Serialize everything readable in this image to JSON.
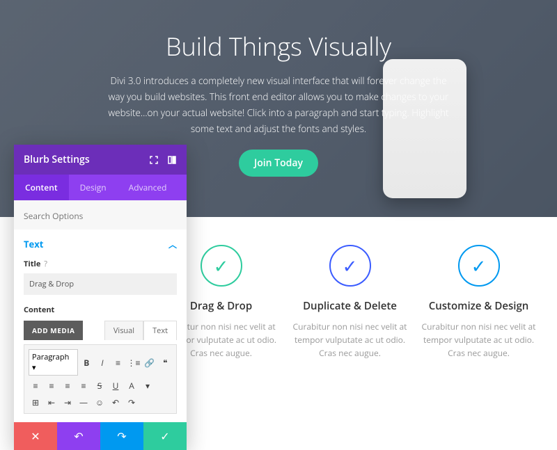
{
  "hero": {
    "title": "Build Things Visually",
    "subtitle": "Divi 3.0 introduces a completely new visual interface that will forever change the way you build websites. This front end editor allows you to make changes to your website...on your actual website! Click into a paragraph and start typing. Highlight some text and adjust the fonts and styles.",
    "cta": "Join Today"
  },
  "features": [
    {
      "title": "Drag & Drop",
      "body": "urabitur non nisi nec velit at tempor vulputate ac ut odio. Cras nec augue."
    },
    {
      "title": "Duplicate & Delete",
      "body": "Curabitur non nisi nec velit at tempor vulputate ac ut odio. Cras nec augue."
    },
    {
      "title": "Customize & Design",
      "body": "Curabitur non nisi nec velit at tempor vulputate ac ut odio. Cras nec augue."
    }
  ],
  "panel": {
    "title": "Blurb Settings",
    "tabs": [
      "Content",
      "Design",
      "Advanced"
    ],
    "searchPlaceholder": "Search Options",
    "section": "Text",
    "titleLabel": "Title",
    "help": "?",
    "titleValue": "Drag & Drop",
    "contentLabel": "Content",
    "addMedia": "ADD MEDIA",
    "editorTabs": [
      "Visual",
      "Text"
    ],
    "paragraphLabel": "Paragraph"
  }
}
